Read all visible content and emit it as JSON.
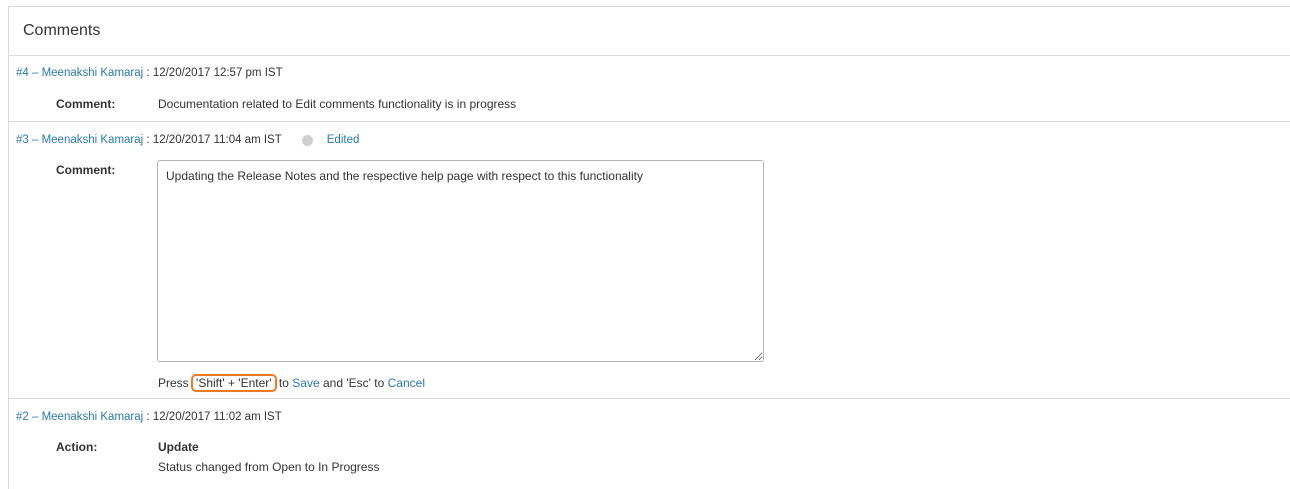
{
  "panel": {
    "title": "Comments"
  },
  "comments": [
    {
      "link": "#4 – Meenakshi Kamaraj",
      "sep": " : ",
      "timestamp": "12/20/2017 12:57 pm IST",
      "field_label": "Comment:",
      "text": "Documentation related to Edit comments functionality is in progress"
    },
    {
      "link": "#3 – Meenakshi Kamaraj",
      "sep": " : ",
      "timestamp": "12/20/2017 11:04 am IST",
      "status": "Edited",
      "field_label": "Comment:",
      "text": "Updating the Release Notes and the respective help page with respect to this functionality",
      "hint": {
        "press": "Press",
        "keys": "'Shift' + 'Enter'",
        "to1": "to",
        "save": "Save",
        "and": "and 'Esc' to",
        "cancel": "Cancel"
      }
    },
    {
      "link": "#2 – Meenakshi Kamaraj",
      "sep": " : ",
      "timestamp": "12/20/2017 11:02 am IST",
      "field_label": "Action:",
      "action_title": "Update",
      "text": "Status changed from Open to In Progress"
    }
  ],
  "colors": {
    "link": "#2a7ab0",
    "highlight": "#f07a22",
    "border": "#dcdcdc"
  }
}
